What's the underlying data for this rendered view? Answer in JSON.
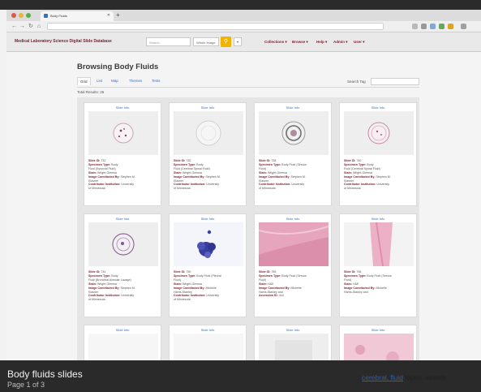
{
  "browser": {
    "tab_title": "Body Fluids",
    "url": "",
    "colors": {
      "close": "#e2574c",
      "minimize": "#e8b53c",
      "maximize": "#58b04a"
    }
  },
  "site": {
    "title": "Medical Laboratory Science Digital Slide Database",
    "search_placeholder": "Search",
    "search_option": "Whole Image",
    "menu": [
      "Collections ▾",
      "Browse ▾",
      "Help ▾",
      "Admin ▾",
      "User ▾"
    ],
    "accent_color": "#7a1f2b"
  },
  "page": {
    "title": "Browsing Body Fluids",
    "tabs": [
      "Grid",
      "List",
      "Map",
      "Themes",
      "Tests"
    ],
    "active_tab": "Grid",
    "search_tag_label": "Search Tag",
    "total_results": "Total Results: 26"
  },
  "cards": [
    {
      "link": "Slide Info",
      "image": "stained-round",
      "meta": [
        {
          "label": "Slide ID:",
          "value": " 732"
        },
        {
          "label": "Specimen Type:",
          "value": " Body"
        },
        {
          "label": "",
          "value": "Fluid (Synovial Fluid)"
        },
        {
          "label": "Stain:",
          "value": " Wright-Giemsa"
        },
        {
          "label": "Image Contributed By:",
          "value": " Stephen M."
        },
        {
          "label": "",
          "value": "Klasner"
        },
        {
          "label": "Contributor Institution:",
          "value": " University"
        },
        {
          "label": "",
          "value": "of Minnesota"
        }
      ]
    },
    {
      "link": "Slide Info",
      "image": "faint-round",
      "meta": [
        {
          "label": "Slide ID:",
          "value": " 735"
        },
        {
          "label": "Specimen Type:",
          "value": " Body"
        },
        {
          "label": "",
          "value": "Fluid (Cerebral Spinal Fluid)"
        },
        {
          "label": "Stain:",
          "value": " Wright-Giemsa"
        },
        {
          "label": "Image Contributed By:",
          "value": " Stephen M."
        },
        {
          "label": "",
          "value": "Klasner"
        },
        {
          "label": "Contributor Institution:",
          "value": " University"
        },
        {
          "label": "",
          "value": "of Minnesota"
        }
      ]
    },
    {
      "link": "Slide Info",
      "image": "ringed-round",
      "meta": [
        {
          "label": "Slide ID:",
          "value": " 738"
        },
        {
          "label": "Specimen Type:",
          "value": " Body Fluid (Serous"
        },
        {
          "label": "",
          "value": "Fluid)"
        },
        {
          "label": "Stain:",
          "value": " Wright-Giemsa"
        },
        {
          "label": "Image Contributed By:",
          "value": " Stephen M."
        },
        {
          "label": "",
          "value": "Klasner"
        },
        {
          "label": "Contributor Institution:",
          "value": " University"
        },
        {
          "label": "",
          "value": "of Minnesota"
        }
      ]
    },
    {
      "link": "Slide Info",
      "image": "pink-round",
      "meta": [
        {
          "label": "Slide ID:",
          "value": " 740"
        },
        {
          "label": "Specimen Type:",
          "value": " Body"
        },
        {
          "label": "",
          "value": "Fluid (Cerebral Spinal Fluid)"
        },
        {
          "label": "Stain:",
          "value": " Wright-Giemsa"
        },
        {
          "label": "Image Contributed By:",
          "value": " Stephen M."
        },
        {
          "label": "",
          "value": "Klasner"
        },
        {
          "label": "Contributor Institution:",
          "value": " University"
        },
        {
          "label": "",
          "value": "of Minnesota"
        }
      ]
    },
    {
      "link": "Slide Info",
      "image": "purple-round",
      "meta": [
        {
          "label": "Slide ID:",
          "value": " 744"
        },
        {
          "label": "Specimen Type:",
          "value": " Body"
        },
        {
          "label": "",
          "value": "Fluid (Bronchial Alveolar Lavage)"
        },
        {
          "label": "Stain:",
          "value": " Wright-Giemsa"
        },
        {
          "label": "Image Contributed By:",
          "value": " Stephen M."
        },
        {
          "label": "",
          "value": "Klasner"
        },
        {
          "label": "Contributor Institution:",
          "value": " University"
        },
        {
          "label": "",
          "value": "of Minnesota"
        }
      ]
    },
    {
      "link": "Slide Info",
      "image": "blue-cluster",
      "meta": [
        {
          "label": "Slide ID:",
          "value": " 750"
        },
        {
          "label": "Specimen Type:",
          "value": " Body Fluid (Pleural"
        },
        {
          "label": "",
          "value": "Fluid)"
        },
        {
          "label": "Stain:",
          "value": " Wright-Giemsa"
        },
        {
          "label": "Image Contributed By:",
          "value": " Michelle"
        },
        {
          "label": "",
          "value": "Harris-Stanley"
        },
        {
          "label": "Contributor Institution:",
          "value": " University"
        },
        {
          "label": "",
          "value": "of Minnesota"
        }
      ]
    },
    {
      "link": "Slide Info",
      "image": "pink-field",
      "meta": [
        {
          "label": "Slide ID:",
          "value": " 755"
        },
        {
          "label": "Specimen Type:",
          "value": " Body Fluid (Serous"
        },
        {
          "label": "",
          "value": "Fluid)"
        },
        {
          "label": "Stain:",
          "value": " H&E"
        },
        {
          "label": "Image Contributed By:",
          "value": " Michelle"
        },
        {
          "label": "",
          "value": "Harris-Stanley and"
        },
        {
          "label": "Accession ID:",
          "value": " 444"
        }
      ]
    },
    {
      "link": "Slide Info",
      "image": "pink-band",
      "meta": [
        {
          "label": "Slide ID:",
          "value": " 756"
        },
        {
          "label": "Specimen Type:",
          "value": " Body Fluid (Serous"
        },
        {
          "label": "",
          "value": "Fluid)"
        },
        {
          "label": "Stain:",
          "value": " H&E"
        },
        {
          "label": "Image Contributed By:",
          "value": " Michelle"
        },
        {
          "label": "",
          "value": "Harris-Stanley and"
        }
      ]
    },
    {
      "link": "Slide Info",
      "image": "blank",
      "meta": []
    },
    {
      "link": "Slide Info",
      "image": "blank",
      "meta": []
    },
    {
      "link": "Slide Info",
      "image": "pale",
      "meta": []
    },
    {
      "link": "Slide Info",
      "image": "pink-tissue",
      "meta": []
    }
  ],
  "caption": {
    "title": "Body fluids slides",
    "page_indicator": "Page 1 of 3",
    "blurred_note": "",
    "right_link": "cerebral, fluid",
    "right_text": " types. stretch"
  }
}
